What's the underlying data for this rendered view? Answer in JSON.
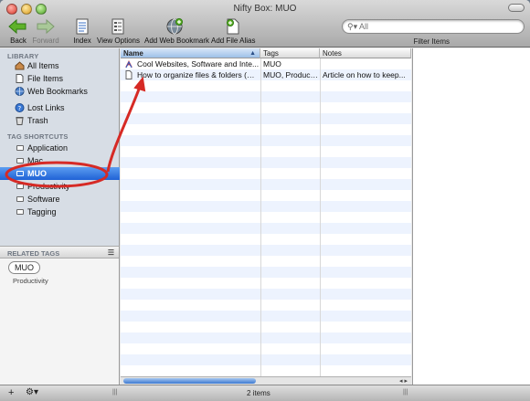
{
  "window": {
    "title": "Nifty Box: MUO"
  },
  "toolbar": {
    "back": "Back",
    "forward": "Forward",
    "index": "Index",
    "view_options": "View Options",
    "add_web_bookmark": "Add Web Bookmark",
    "add_file_alias": "Add File Alias",
    "search_placeholder": "All",
    "filter_items": "Filter Items"
  },
  "sidebar": {
    "library_header": "LIBRARY",
    "library": [
      {
        "label": "All Items",
        "icon": "house-icon"
      },
      {
        "label": "File Items",
        "icon": "document-icon"
      },
      {
        "label": "Web Bookmarks",
        "icon": "globe-icon"
      },
      {
        "label": "Lost Links",
        "icon": "question-icon"
      },
      {
        "label": "Trash",
        "icon": "trash-icon"
      }
    ],
    "tags_header": "TAG SHORTCUTS",
    "tags": [
      {
        "label": "Application"
      },
      {
        "label": "Mac"
      },
      {
        "label": "MUO",
        "selected": true
      },
      {
        "label": "Productivity"
      },
      {
        "label": "Software"
      },
      {
        "label": "Tagging"
      }
    ]
  },
  "related": {
    "header": "RELATED TAGS",
    "chip": "MUO",
    "other": "Productivity"
  },
  "list": {
    "columns": {
      "name": "Name",
      "tags": "Tags",
      "notes": "Notes"
    },
    "rows": [
      {
        "name": "Cool Websites, Software and Inte...",
        "tags": "MUO",
        "notes": "",
        "icon": "bookmark-icon"
      },
      {
        "name": "How to organize files & folders (Mac)",
        "tags": "MUO, Product...",
        "notes": "Article on how to keep...",
        "icon": "document-icon"
      }
    ]
  },
  "status": {
    "count": "2 items"
  },
  "colors": {
    "selection": "#1f62d6",
    "annotation": "#d62a25",
    "alt_row": "#edf3fe"
  }
}
